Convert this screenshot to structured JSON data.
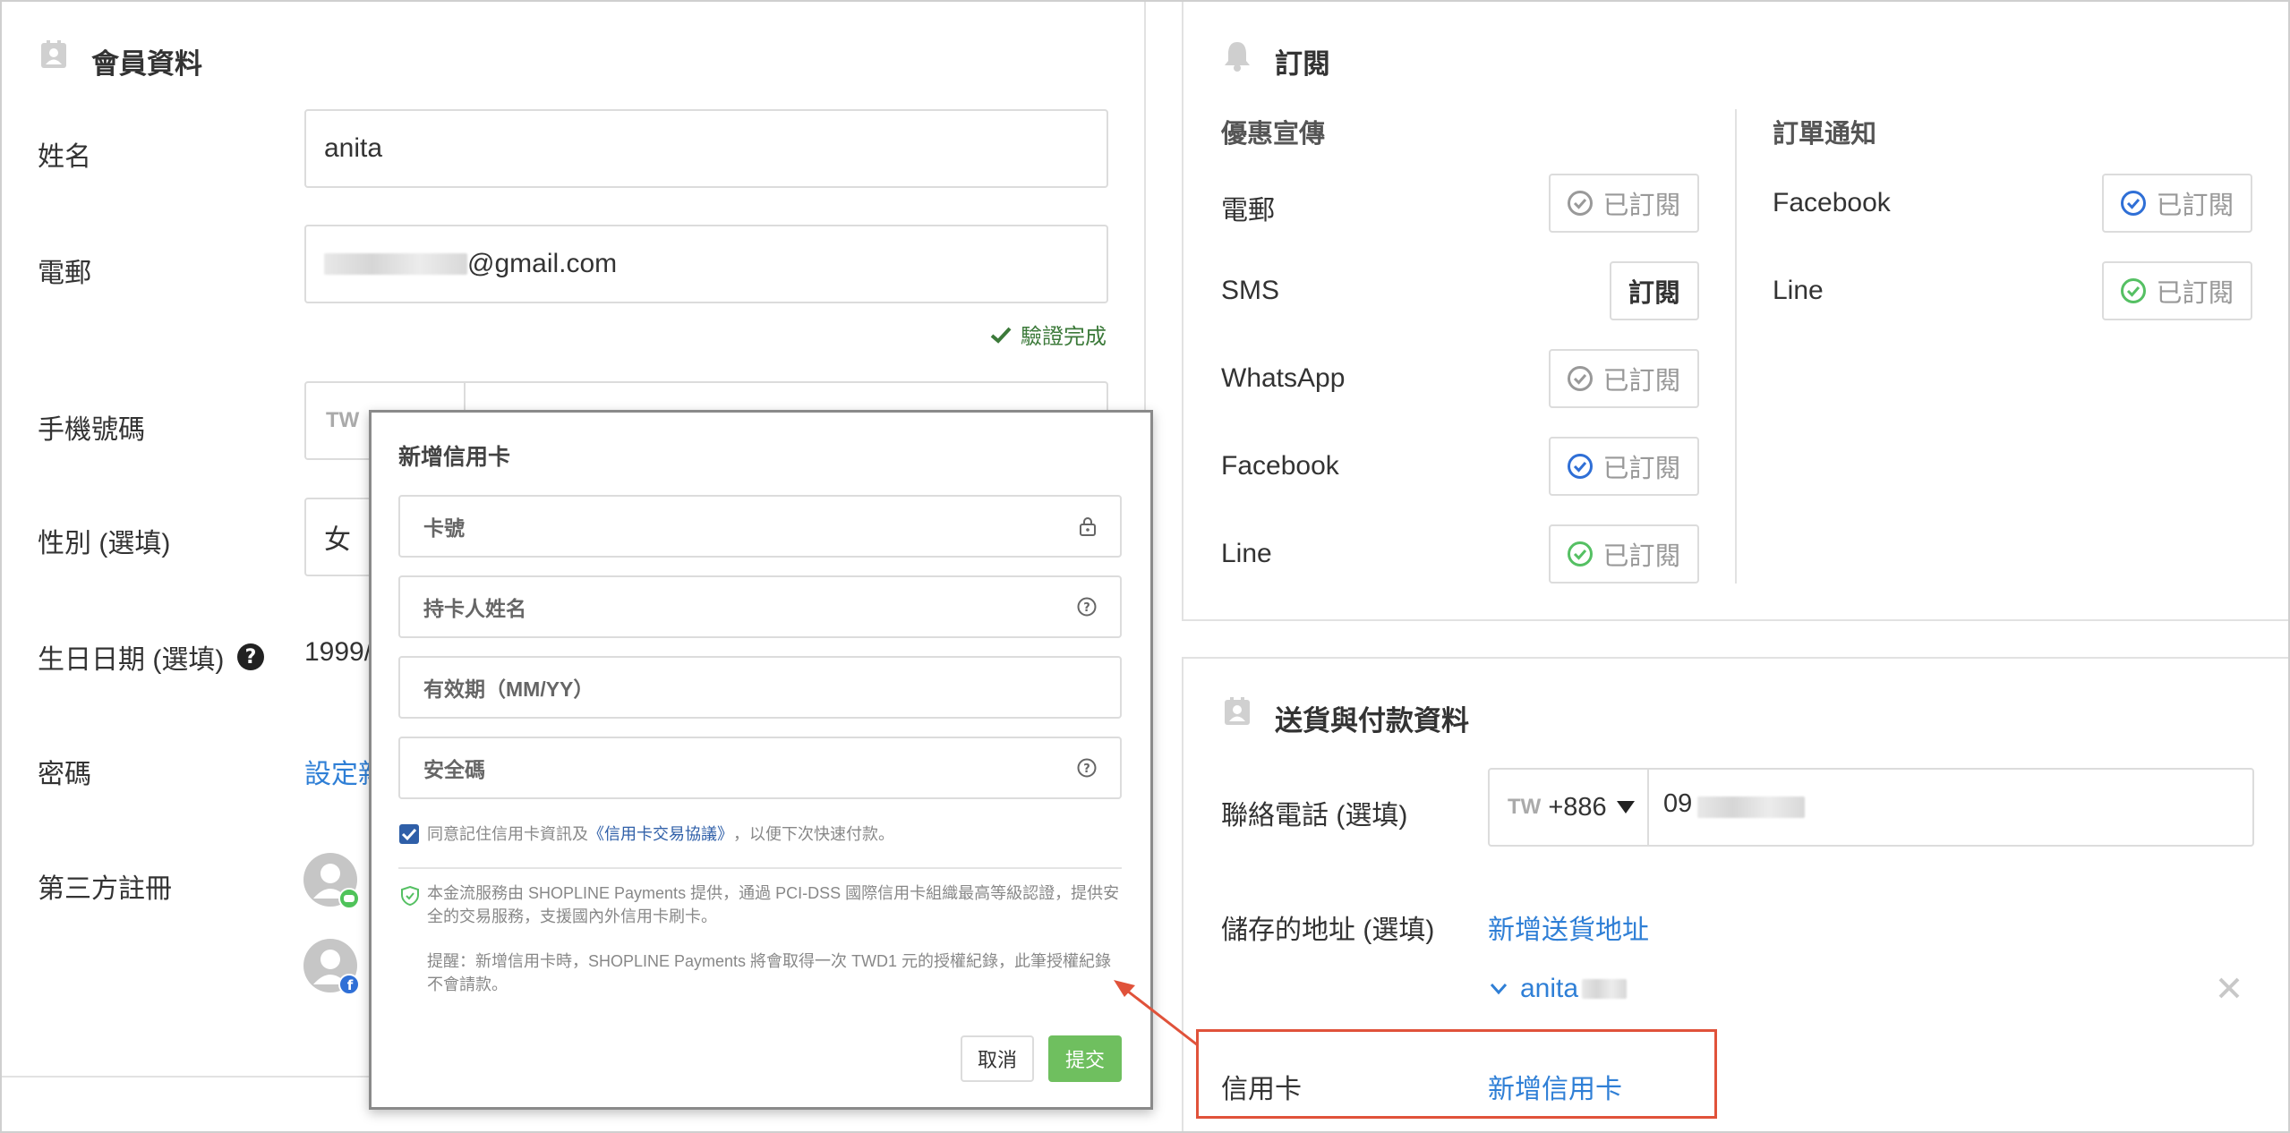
{
  "member": {
    "title": "會員資料",
    "name_label": "姓名",
    "name_value": "anita",
    "email_label": "電郵",
    "email_suffix": "@gmail.com",
    "verified_text": "驗證完成",
    "phone_label": "手機號碼",
    "phone_country": "TW",
    "gender_label": "性別 (選填)",
    "gender_value": "女",
    "birthday_label": "生日日期 (選填)",
    "birthday_value": "1999/",
    "password_label": "密碼",
    "password_link": "設定新",
    "third_party_label": "第三方註冊"
  },
  "subscription": {
    "title": "訂閱",
    "promo_header": "優惠宣傳",
    "order_header": "訂單通知",
    "promo_items": [
      {
        "label": "電郵",
        "button": "已訂閱"
      },
      {
        "label": "SMS",
        "button": "訂閱"
      },
      {
        "label": "WhatsApp",
        "button": "已訂閱"
      },
      {
        "label": "Facebook",
        "button": "已訂閱"
      },
      {
        "label": "Line",
        "button": "已訂閱"
      }
    ],
    "order_items": [
      {
        "label": "Facebook",
        "button": "已訂閱"
      },
      {
        "label": "Line",
        "button": "已訂閱"
      }
    ]
  },
  "delivery": {
    "title": "送貨與付款資料",
    "phone_label": "聯絡電話 (選填)",
    "phone_country": "TW",
    "phone_code": "+886",
    "phone_value": "09",
    "address_label": "儲存的地址 (選填)",
    "add_address_link": "新增送貨地址",
    "address_name": "anita",
    "card_label": "信用卡",
    "add_card_link": "新增信用卡"
  },
  "modal": {
    "title": "新增信用卡",
    "card_number_placeholder": "卡號",
    "holder_placeholder": "持卡人姓名",
    "expiry_placeholder": "有效期（MM/YY）",
    "cvv_placeholder": "安全碼",
    "remember_prefix": "同意記住信用卡資訊及",
    "remember_link": "《信用卡交易協議》",
    "remember_suffix": "，以便下次快速付款。",
    "security_note": "本金流服務由 SHOPLINE Payments 提供，通過 PCI-DSS 國際信用卡組織最高等級認證，提供安全的交易服務，支援國內外信用卡刷卡。",
    "reminder_note": "提醒：新增信用卡時，SHOPLINE Payments 將會取得一次 TWD1 元的授權紀錄，此筆授權紀錄不會請款。",
    "cancel_label": "取消",
    "submit_label": "提交"
  },
  "colors": {
    "link": "#2f7fd6",
    "verified": "#3c7a3a",
    "submit": "#6fbf5f",
    "highlight": "#e0523a",
    "check_blue": "#2f6fd6",
    "check_green": "#55c063",
    "check_gray": "#999999"
  }
}
